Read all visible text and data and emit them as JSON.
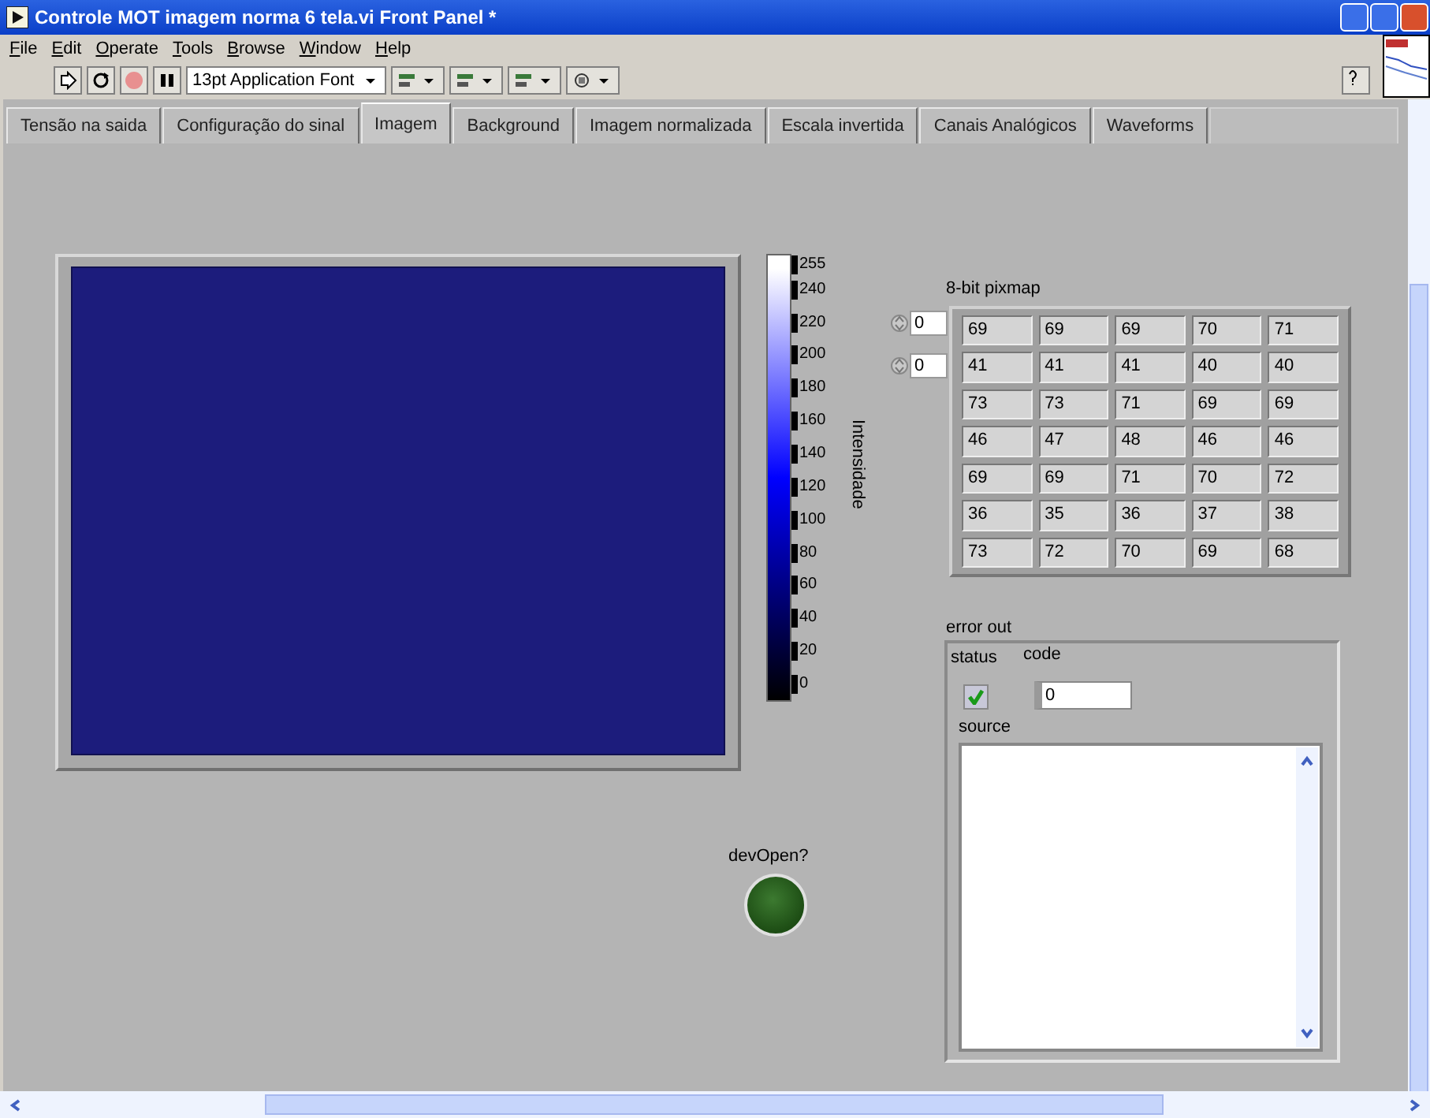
{
  "window": {
    "title": "Controle MOT imagem norma 6 tela.vi Front Panel *"
  },
  "menu": [
    {
      "label": "File"
    },
    {
      "label": "Edit"
    },
    {
      "label": "Operate"
    },
    {
      "label": "Tools"
    },
    {
      "label": "Browse"
    },
    {
      "label": "Window"
    },
    {
      "label": "Help"
    }
  ],
  "toolbar": {
    "font": "13pt Application Font"
  },
  "tabs": [
    {
      "label": "Tensão na saida",
      "selected": false
    },
    {
      "label": "Configuração do sinal",
      "selected": false
    },
    {
      "label": "Imagem",
      "selected": true
    },
    {
      "label": "Background",
      "selected": false
    },
    {
      "label": "Imagem normalizada",
      "selected": false
    },
    {
      "label": "Escala invertida",
      "selected": false
    },
    {
      "label": "Canais Analógicos",
      "selected": false
    },
    {
      "label": "Waveforms",
      "selected": false
    }
  ],
  "graph": {
    "colorbar_label": "Intensidade",
    "ticks": [
      "255",
      "240",
      "220",
      "200",
      "180",
      "160",
      "140",
      "120",
      "100",
      "80",
      "60",
      "40",
      "20",
      "0"
    ]
  },
  "pixmap": {
    "label": "8-bit pixmap",
    "row_index": "0",
    "column_index": "0",
    "rows": [
      [
        "69",
        "69",
        "69",
        "70",
        "71"
      ],
      [
        "41",
        "41",
        "41",
        "40",
        "40"
      ],
      [
        "73",
        "73",
        "71",
        "69",
        "69"
      ],
      [
        "46",
        "47",
        "48",
        "46",
        "46"
      ],
      [
        "69",
        "69",
        "71",
        "70",
        "72"
      ],
      [
        "36",
        "35",
        "36",
        "37",
        "38"
      ],
      [
        "73",
        "72",
        "70",
        "69",
        "68"
      ]
    ]
  },
  "error_out": {
    "label": "error out",
    "status_label": "status",
    "status": {
      "checked": true
    },
    "code_label": "code",
    "code": "0",
    "source_label": "source"
  },
  "led": {
    "label": "devOpen?",
    "on": false
  }
}
